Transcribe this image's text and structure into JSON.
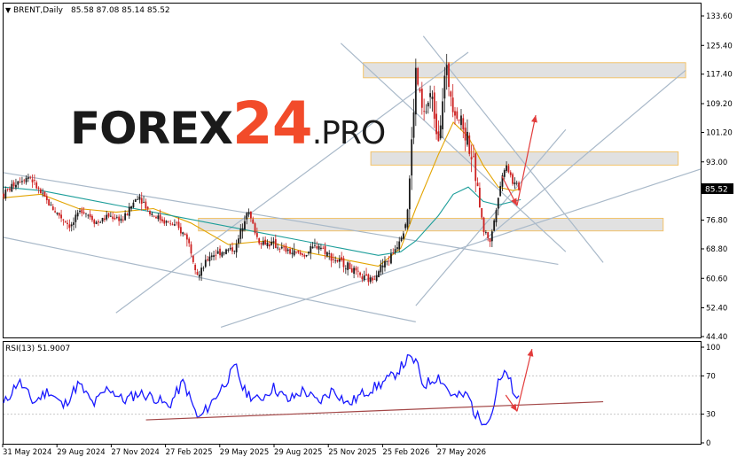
{
  "header": {
    "symbol": "BRENT,Daily",
    "ohlc": "85.58 87.08 85.14 85.52"
  },
  "logo": {
    "word": "FOREX",
    "number": "24",
    "suffix": ".PRO"
  },
  "colors": {
    "background": "#ffffff",
    "frame": "#000000",
    "grid": "#c8c8c8",
    "candle_up": "#1a1a1a",
    "candle_down": "#cc1f1f",
    "ma_fast": "#e3a400",
    "ma_slow": "#1d9e9a",
    "trendline": "#a9b9c9",
    "zone_fill": "#dcdcdc",
    "zone_border": "#f2c36b",
    "arrow": "#e23b3b",
    "rsi_line": "#1a1aff",
    "rsi_support": "#a34747",
    "price_badge": "#000000",
    "logo_text": "#1a1a1a",
    "logo_accent": "#f24b2a"
  },
  "chart_data": [
    {
      "type": "candlestick",
      "symbol": "BRENT",
      "timeframe": "Daily",
      "last_price": "85.52",
      "y_axis_ticks": [
        "133.60",
        "125.40",
        "117.40",
        "109.20",
        "101.20",
        "93.00",
        "85.00",
        "76.80",
        "68.80",
        "60.60",
        "52.40",
        "44.40"
      ],
      "x_axis_ticks": [
        "31 May 2024",
        "29 Aug 2024",
        "27 Nov 2024",
        "27 Feb 2025",
        "29 May 2025",
        "29 Aug 2025",
        "25 Nov 2025",
        "25 Feb 2026",
        "27 May 2026"
      ],
      "ylim": [
        44.4,
        133.6
      ],
      "grid": true,
      "price_path": [
        [
          0,
          84
        ],
        [
          4,
          88
        ],
        [
          7,
          89
        ],
        [
          10,
          84
        ],
        [
          14,
          79
        ],
        [
          18,
          75
        ],
        [
          21,
          80
        ],
        [
          25,
          76
        ],
        [
          28,
          78
        ],
        [
          32,
          77
        ],
        [
          36,
          84
        ],
        [
          39,
          79
        ],
        [
          42,
          77
        ],
        [
          46,
          75
        ],
        [
          49,
          72
        ],
        [
          52,
          61
        ],
        [
          55,
          67
        ],
        [
          58,
          68
        ],
        [
          62,
          69
        ],
        [
          65,
          80
        ],
        [
          68,
          71
        ],
        [
          72,
          70
        ],
        [
          76,
          68
        ],
        [
          80,
          67
        ],
        [
          84,
          70
        ],
        [
          88,
          66
        ],
        [
          92,
          64
        ],
        [
          95,
          61
        ],
        [
          98,
          60
        ],
        [
          100,
          63
        ],
        [
          103,
          66
        ],
        [
          105,
          70
        ],
        [
          107,
          75
        ],
        [
          108,
          82
        ],
        [
          110,
          118
        ],
        [
          112,
          105
        ],
        [
          114,
          112
        ],
        [
          116,
          100
        ],
        [
          118,
          119
        ],
        [
          120,
          109
        ],
        [
          122,
          104
        ],
        [
          124,
          99
        ],
        [
          126,
          89
        ],
        [
          128,
          74
        ],
        [
          130,
          71
        ],
        [
          132,
          84
        ],
        [
          134,
          93
        ],
        [
          136,
          87
        ],
        [
          138,
          85.5
        ]
      ],
      "moving_averages": [
        {
          "name": "MA fast",
          "path": [
            [
              0,
              83
            ],
            [
              10,
              84
            ],
            [
              20,
              80
            ],
            [
              30,
              79
            ],
            [
              40,
              80
            ],
            [
              50,
              76
            ],
            [
              60,
              70
            ],
            [
              70,
              71
            ],
            [
              80,
              68
            ],
            [
              90,
              66
            ],
            [
              100,
              64
            ],
            [
              106,
              69
            ],
            [
              110,
              80
            ],
            [
              116,
              95
            ],
            [
              120,
              104
            ],
            [
              124,
              100
            ],
            [
              128,
              92
            ],
            [
              132,
              86
            ],
            [
              136,
              85
            ],
            [
              138,
              85.5
            ]
          ]
        },
        {
          "name": "MA slow",
          "path": [
            [
              0,
              86
            ],
            [
              10,
              85
            ],
            [
              20,
              83
            ],
            [
              30,
              81
            ],
            [
              40,
              79
            ],
            [
              50,
              77
            ],
            [
              60,
              75
            ],
            [
              70,
              73
            ],
            [
              80,
              71
            ],
            [
              90,
              69
            ],
            [
              100,
              67
            ],
            [
              106,
              68
            ],
            [
              110,
              71
            ],
            [
              116,
              78
            ],
            [
              120,
              84
            ],
            [
              124,
              86
            ],
            [
              128,
              82
            ],
            [
              132,
              81
            ],
            [
              136,
              82
            ],
            [
              138,
              82.5
            ]
          ]
        }
      ],
      "zones": [
        {
          "x": [
            96,
            182
          ],
          "y": [
            116.4,
            120.6
          ]
        },
        {
          "x": [
            98,
            180
          ],
          "y": [
            92.1,
            95.8
          ]
        },
        {
          "x": [
            52,
            176
          ],
          "y": [
            73.8,
            77.3
          ]
        }
      ],
      "trendlines": [
        {
          "from": [
            0,
            90
          ],
          "to": [
            148,
            64.5
          ]
        },
        {
          "from": [
            0,
            72
          ],
          "to": [
            110,
            48.5
          ]
        },
        {
          "from": [
            30,
            51
          ],
          "to": [
            124,
            123.5
          ]
        },
        {
          "from": [
            58,
            47
          ],
          "to": [
            186,
            91
          ]
        },
        {
          "from": [
            90,
            126
          ],
          "to": [
            150,
            68
          ]
        },
        {
          "from": [
            112,
            128
          ],
          "to": [
            160,
            65
          ]
        },
        {
          "from": [
            110,
            53
          ],
          "to": [
            150,
            102
          ]
        },
        {
          "from": [
            128,
            71
          ],
          "to": [
            182,
            118.5
          ]
        }
      ],
      "forecast_arrows": [
        {
          "from": [
            133,
            89
          ],
          "to": [
            137,
            80.8
          ]
        },
        {
          "from": [
            137,
            80.8
          ],
          "to": [
            142,
            106
          ]
        }
      ]
    },
    {
      "type": "line",
      "indicator": "RSI(13)",
      "label": "RSI(13) 51.9007",
      "value": "51.9007",
      "y_axis_ticks": [
        "100",
        "70",
        "30",
        "0"
      ],
      "ylim": [
        0,
        100
      ],
      "levels": [
        70,
        30
      ],
      "rsi_path": [
        [
          0,
          40
        ],
        [
          4,
          65
        ],
        [
          8,
          42
        ],
        [
          12,
          55
        ],
        [
          16,
          38
        ],
        [
          20,
          62
        ],
        [
          24,
          40
        ],
        [
          28,
          58
        ],
        [
          32,
          44
        ],
        [
          36,
          52
        ],
        [
          40,
          48
        ],
        [
          44,
          38
        ],
        [
          48,
          64
        ],
        [
          52,
          24
        ],
        [
          56,
          45
        ],
        [
          60,
          68
        ],
        [
          62,
          80
        ],
        [
          64,
          55
        ],
        [
          68,
          44
        ],
        [
          72,
          58
        ],
        [
          76,
          44
        ],
        [
          80,
          55
        ],
        [
          84,
          42
        ],
        [
          88,
          56
        ],
        [
          92,
          40
        ],
        [
          96,
          52
        ],
        [
          100,
          60
        ],
        [
          104,
          70
        ],
        [
          108,
          88
        ],
        [
          110,
          85
        ],
        [
          112,
          60
        ],
        [
          116,
          70
        ],
        [
          120,
          48
        ],
        [
          124,
          50
        ],
        [
          126,
          28
        ],
        [
          128,
          24
        ],
        [
          130,
          26
        ],
        [
          132,
          62
        ],
        [
          134,
          72
        ],
        [
          135,
          70
        ],
        [
          136,
          45
        ],
        [
          138,
          52
        ]
      ],
      "support_line": {
        "from": [
          38,
          24
        ],
        "to": [
          160,
          43
        ]
      },
      "forecast_arrows": [
        {
          "from": [
            134,
            50
          ],
          "to": [
            137,
            33
          ]
        },
        {
          "from": [
            137,
            33
          ],
          "to": [
            141,
            98
          ]
        }
      ]
    }
  ]
}
